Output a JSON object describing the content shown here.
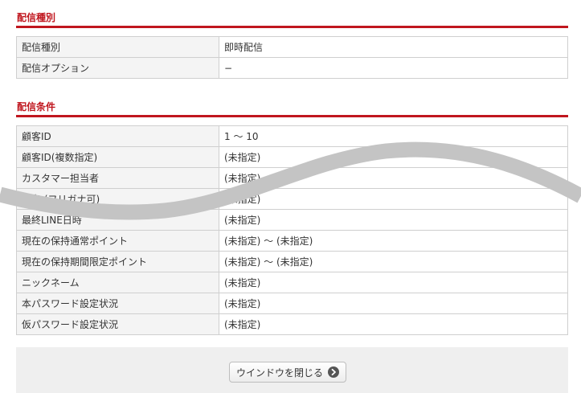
{
  "delivery_type_section": {
    "heading": "配信種別",
    "rows": [
      {
        "label": "配信種別",
        "value": "即時配信"
      },
      {
        "label": "配信オプション",
        "value": "−"
      }
    ]
  },
  "delivery_conditions_section": {
    "heading": "配信条件",
    "rows": [
      {
        "label": "顧客ID",
        "value": "1 ～ 10"
      },
      {
        "label": "顧客ID(複数指定)",
        "value": "(未指定)"
      },
      {
        "label": "カスタマー担当者",
        "value": "(未指定)"
      },
      {
        "label": "氏名 (フリガナ可)",
        "value": "(未指定)"
      },
      {
        "label": "最終LINE日時",
        "value": "(未指定)"
      },
      {
        "label": "現在の保持通常ポイント",
        "value": "(未指定) ～ (未指定)"
      },
      {
        "label": "現在の保持期間限定ポイント",
        "value": "(未指定) ～ (未指定)"
      },
      {
        "label": "ニックネーム",
        "value": "(未指定)"
      },
      {
        "label": "本パスワード設定状況",
        "value": "(未指定)"
      },
      {
        "label": "仮パスワード設定状況",
        "value": "(未指定)"
      }
    ]
  },
  "footer": {
    "close_button_label": "ウインドウを閉じる",
    "close_button_icon": "arrow-right-circle-icon"
  },
  "colors": {
    "accent": "#c0161e",
    "label_bg": "#f4f4f4",
    "border": "#cfcfcf",
    "footer_bg": "#efefef",
    "overlay_band": "#c4c4c4"
  }
}
